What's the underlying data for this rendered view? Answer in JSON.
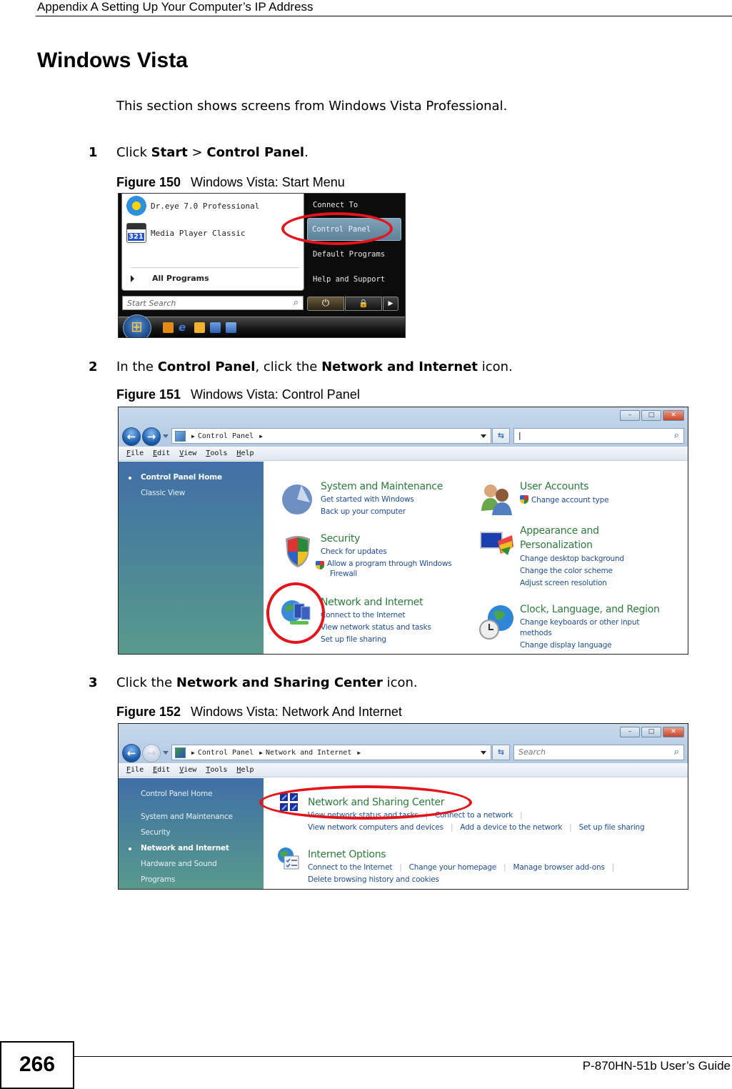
{
  "header": {
    "chapter": "Appendix A Setting Up Your Computer’s IP Address"
  },
  "section": {
    "title": "Windows Vista",
    "intro": "This section shows screens from Windows Vista Professional."
  },
  "steps": [
    {
      "num": "1",
      "parts": [
        "Click ",
        "Start",
        " > ",
        "Control Panel",
        "."
      ]
    },
    {
      "num": "2",
      "parts": [
        "In the ",
        "Control Panel",
        ", click the ",
        "Network and Internet",
        " icon."
      ]
    },
    {
      "num": "3",
      "parts": [
        "Click the ",
        "Network and Sharing Center",
        " icon."
      ]
    }
  ],
  "figures": [
    {
      "label": "Figure 150",
      "caption": "Windows Vista: Start Menu"
    },
    {
      "label": "Figure 151",
      "caption": "Windows Vista: Control Panel"
    },
    {
      "label": "Figure 152",
      "caption": "Windows Vista: Network And Internet"
    }
  ],
  "start_menu": {
    "programs": [
      "Dr.eye 7.0 Professional",
      "Media Player Classic"
    ],
    "mpc_badge": "321",
    "all_programs": "All Programs",
    "search_placeholder": "Start Search",
    "right_items": [
      "Connect To",
      "Control Panel",
      "Default Programs",
      "Help and Support"
    ],
    "highlighted_item": "Control Panel"
  },
  "control_panel": {
    "breadcrumb": [
      "Control Panel"
    ],
    "search_value": "|",
    "menu": [
      "File",
      "Edit",
      "View",
      "Tools",
      "Help"
    ],
    "sidebar": [
      {
        "label": "Control Panel Home",
        "active": true
      },
      {
        "label": "Classic View",
        "active": false
      }
    ],
    "categories": [
      {
        "title": "System and Maintenance",
        "links": [
          "Get started with Windows",
          "Back up your computer"
        ]
      },
      {
        "title": "Security",
        "links": [
          "Check for updates",
          "Allow a program through Windows",
          "Firewall"
        ]
      },
      {
        "title": "Network and Internet",
        "links": [
          "Connect to the Internet",
          "View network status and tasks",
          "Set up file sharing"
        ]
      },
      {
        "title": "User Accounts",
        "links": [
          "Change account type"
        ]
      },
      {
        "title_lines": [
          "Appearance and",
          "Personalization"
        ],
        "links": [
          "Change desktop background",
          "Change the color scheme",
          "Adjust screen resolution"
        ]
      },
      {
        "title": "Clock, Language, and Region",
        "links": [
          "Change keyboards or other input",
          "methods",
          "Change display language"
        ]
      }
    ]
  },
  "network_internet": {
    "breadcrumb": [
      "Control Panel",
      "Network and Internet"
    ],
    "search_placeholder": "Search",
    "menu": [
      "File",
      "Edit",
      "View",
      "Tools",
      "Help"
    ],
    "sidebar": [
      {
        "label": "Control Panel Home",
        "active": false
      },
      {
        "label": "System and Maintenance",
        "active": false
      },
      {
        "label": "Security",
        "active": false
      },
      {
        "label": "Network and Internet",
        "active": true
      },
      {
        "label": "Hardware and Sound",
        "active": false
      },
      {
        "label": "Programs",
        "active": false
      }
    ],
    "sections": [
      {
        "title": "Network and Sharing Center",
        "rows": [
          [
            "View network status and tasks",
            "Connect to a network"
          ],
          [
            "View network computers and devices",
            "Add a device to the network",
            "Set up file sharing"
          ]
        ]
      },
      {
        "title": "Internet Options",
        "rows": [
          [
            "Connect to the Internet",
            "Change your homepage",
            "Manage browser add-ons"
          ],
          [
            "Delete browsing history and cookies"
          ]
        ]
      }
    ]
  },
  "colors": {
    "highlight_ring": "#e4141b",
    "category_title": "#2e7a3e",
    "link": "#1f4d9a"
  },
  "footer": {
    "page_number": "266",
    "guide": "P-870HN-51b User’s Guide"
  }
}
